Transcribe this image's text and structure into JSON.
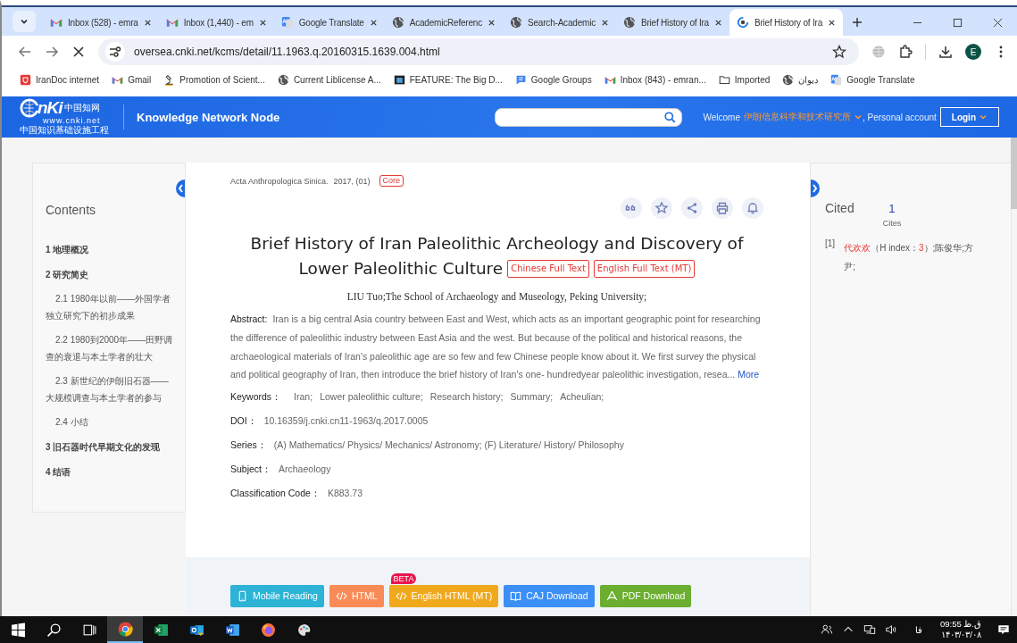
{
  "browser": {
    "tabs": [
      {
        "title": "Inbox (528) - emra",
        "kind": "gmail",
        "selected": false
      },
      {
        "title": "Inbox (1,440) - em",
        "kind": "gmail",
        "selected": false
      },
      {
        "title": "Google Translate",
        "kind": "translate",
        "selected": false
      },
      {
        "title": "AcademicReferenc",
        "kind": "globe",
        "selected": false
      },
      {
        "title": "Search-Academic",
        "kind": "globe",
        "selected": false
      },
      {
        "title": "Brief History of Ira",
        "kind": "globe",
        "selected": false
      },
      {
        "title": "Brief History of Ira",
        "kind": "loading",
        "selected": true
      }
    ],
    "address": "oversea.cnki.net/kcms/detail/11.1963.q.20160315.1639.004.html",
    "profile": "E",
    "bookmarks": [
      {
        "label": "IranDoc internet",
        "kind": "shield"
      },
      {
        "label": "Gmail",
        "kind": "gmail"
      },
      {
        "label": "Promotion of Scient...",
        "kind": "microscope"
      },
      {
        "label": "Current Liblicense A...",
        "kind": "globe"
      },
      {
        "label": "FEATURE: The Big D...",
        "kind": "film"
      },
      {
        "label": "Google Groups",
        "kind": "groups"
      },
      {
        "label": "Inbox (843) - emran...",
        "kind": "gmail"
      },
      {
        "label": "Imported",
        "kind": "folder"
      },
      {
        "label": "دیوان",
        "kind": "globe"
      },
      {
        "label": "Google Translate",
        "kind": "translate"
      }
    ]
  },
  "site": {
    "logo": {
      "mark": "nKi",
      "name": "中国知网",
      "url": "www.cnki.net",
      "slogan": "中国知识基础设施工程"
    },
    "title": "Knowledge Network Node",
    "welcome": "Welcome",
    "org": "伊朗信息科学和技术研究所",
    "account": ", Personal account",
    "login": "Login"
  },
  "contents": {
    "title": "Contents",
    "items": [
      {
        "label": "1 地理概况"
      },
      {
        "label": "2 研究简史",
        "children": [
          {
            "label": "2.1 1980年以前——外国学者独立研究下的初步成果"
          },
          {
            "label": "2.2 1980到2000年——田野调查的衰退与本土学者的壮大"
          },
          {
            "label": "2.3 新世纪的伊朗旧石器——大规模调查与本土学者的参与"
          },
          {
            "label": "2.4 小结"
          }
        ]
      },
      {
        "label": "3 旧石器时代早期文化的发现"
      },
      {
        "label": "4 结语"
      }
    ]
  },
  "article": {
    "source": "Acta Anthropologica Sinica.",
    "issue": "2017, (01)",
    "tag": "Core",
    "title_lines": [
      "Brief History of Iran Paleolithic Archeology and Discovery of",
      "Lower Paleolithic Culture"
    ],
    "full_text_links": [
      "Chinese Full Text",
      "English Full Text (MT)"
    ],
    "authors": "LIU Tuo;The School of Archaeology and Museology, Peking University;",
    "abstract_label": "Abstract:",
    "abstract": "Iran is a big central Asia country between East and West, which acts as an important geographic point for researching the difference of paleolithic industry between East Asia and the west. But because of the political and historical reasons, the archaeological materials of Iran's paleolithic age are so few and few Chinese people know about it. We first survey the physical and political geography of Iran, then introduce the brief history of Iran's one- hundredyear paleolithic investigation, resea...",
    "more": "More",
    "keywords_label": "Keywords：",
    "keywords": [
      "Iran;",
      "Lower paleolithic culture;",
      "Research history;",
      "Summary;",
      "Acheulian;"
    ],
    "fields": [
      {
        "label": "DOI：",
        "value": "10.16359/j.cnki.cn11-1963/q.2017.0005"
      },
      {
        "label": "Series：",
        "value": "(A) Mathematics/ Physics/ Mechanics/ Astronomy; (F) Literature/ History/ Philosophy"
      },
      {
        "label": "Subject：",
        "value": "Archaeology"
      },
      {
        "label": "Classification Code：",
        "value": "K883.73"
      }
    ],
    "buttons": [
      {
        "label": "Mobile Reading",
        "kind": "mobile",
        "color": "#2cb3d6"
      },
      {
        "label": "HTML",
        "kind": "code",
        "color": "#f98b58"
      },
      {
        "label": "English HTML (MT)",
        "kind": "code",
        "color": "#f0a91c",
        "badge": "BETA"
      },
      {
        "label": "CAJ Download",
        "kind": "book",
        "color": "#3b8ff5"
      },
      {
        "label": "PDF Download",
        "kind": "pdf",
        "color": "#6bae30"
      }
    ]
  },
  "cited": {
    "title": "Cited",
    "count": "1",
    "unit": "Cites",
    "items": [
      {
        "num": "[1]",
        "author": "代欢欢",
        "h_open": "（H index：",
        "h_value": "3",
        "rest": "）;陈俊华;方尹;"
      }
    ]
  },
  "taskbar": {
    "apps": [
      {
        "kind": "windows"
      },
      {
        "kind": "search"
      },
      {
        "kind": "taskview"
      },
      {
        "kind": "chrome",
        "active": true
      },
      {
        "kind": "excel",
        "active": false
      },
      {
        "kind": "outlook",
        "active": false
      },
      {
        "kind": "word",
        "active": false
      },
      {
        "kind": "firefox",
        "active": false
      },
      {
        "kind": "paint",
        "active": false
      }
    ],
    "language": "فا",
    "time": "09:55 ق.ظ",
    "date": "۱۴۰۳/۰۳/۰۸"
  }
}
